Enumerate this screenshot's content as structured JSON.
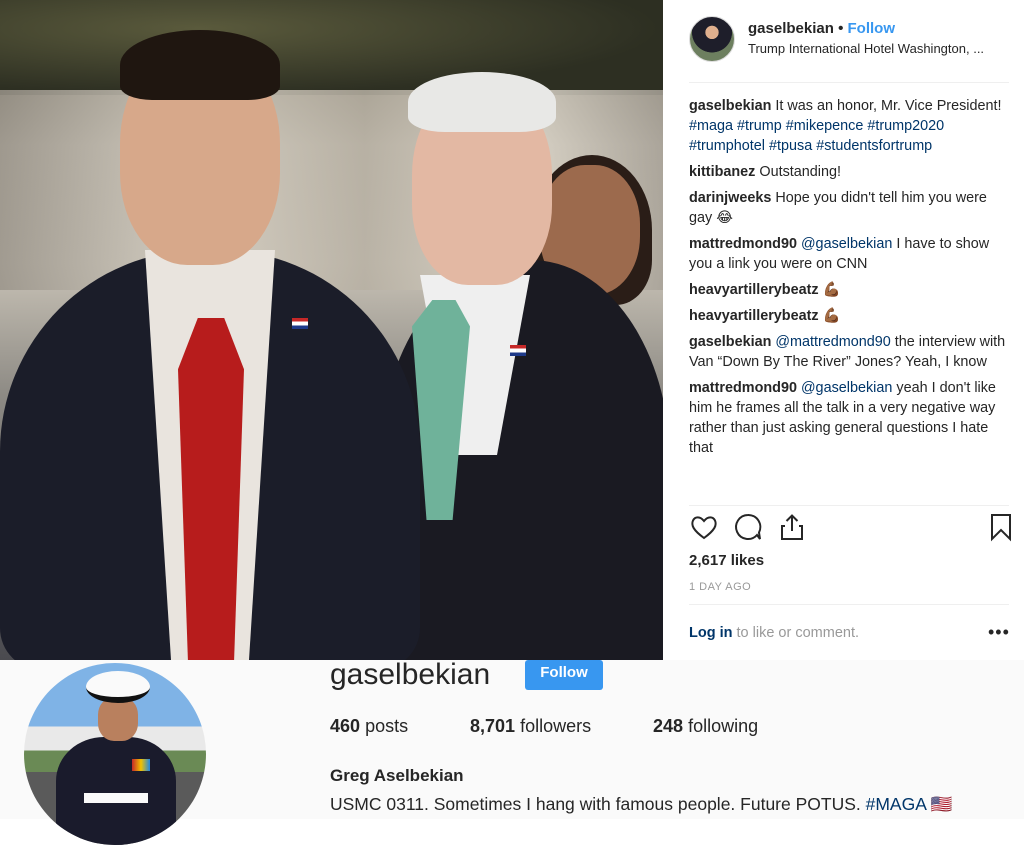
{
  "post": {
    "username": "gaselbekian",
    "separator": "•",
    "follow_label": "Follow",
    "location": "Trump International Hotel Washington, ..."
  },
  "comments": [
    {
      "user": "gaselbekian",
      "text": "It was an honor, Mr. Vice President!",
      "tags": "#maga #trump #mikepence #trump2020 #trumphotel #tpusa #studentsfortrump"
    },
    {
      "user": "kittibanez",
      "text": "Outstanding!"
    },
    {
      "user": "darinjweeks",
      "text": "Hope you didn't tell him you were gay 😂"
    },
    {
      "user": "mattredmond90",
      "mention": "@gaselbekian",
      "text": "I have to show you a link you were on CNN"
    },
    {
      "user": "heavyartillerybeatz",
      "text": "💪🏾"
    },
    {
      "user": "heavyartillerybeatz",
      "text": "💪🏾"
    },
    {
      "user": "gaselbekian",
      "mention": "@mattredmond90",
      "text": "the interview with Van “Down By The River” Jones? Yeah, I know"
    },
    {
      "user": "mattredmond90",
      "mention": "@gaselbekian",
      "text": "yeah I don't like him he frames all the talk in a very negative way rather than just asking general questions I hate that"
    }
  ],
  "actions": {
    "like_icon": "heart-icon",
    "comment_icon": "comment-icon",
    "share_icon": "share-icon",
    "save_icon": "bookmark-icon"
  },
  "likes": "2,617 likes",
  "time_ago": "1 DAY AGO",
  "login": {
    "link": "Log in",
    "text": " to like or comment."
  },
  "more_label": "•••",
  "profile": {
    "username": "gaselbekian",
    "follow_label": "Follow",
    "posts_count": "460",
    "posts_label": "posts",
    "followers_count": "8,701",
    "followers_label": "followers",
    "following_count": "248",
    "following_label": "following",
    "full_name": "Greg Aselbekian",
    "bio": "USMC 0311. Sometimes I hang with famous people. Future POTUS. ",
    "bio_tag": "#MAGA",
    "bio_flag": "🇺🇸"
  },
  "colors": {
    "link": "#3897f0",
    "tag": "#003569",
    "text": "#262626",
    "muted": "#999999"
  }
}
